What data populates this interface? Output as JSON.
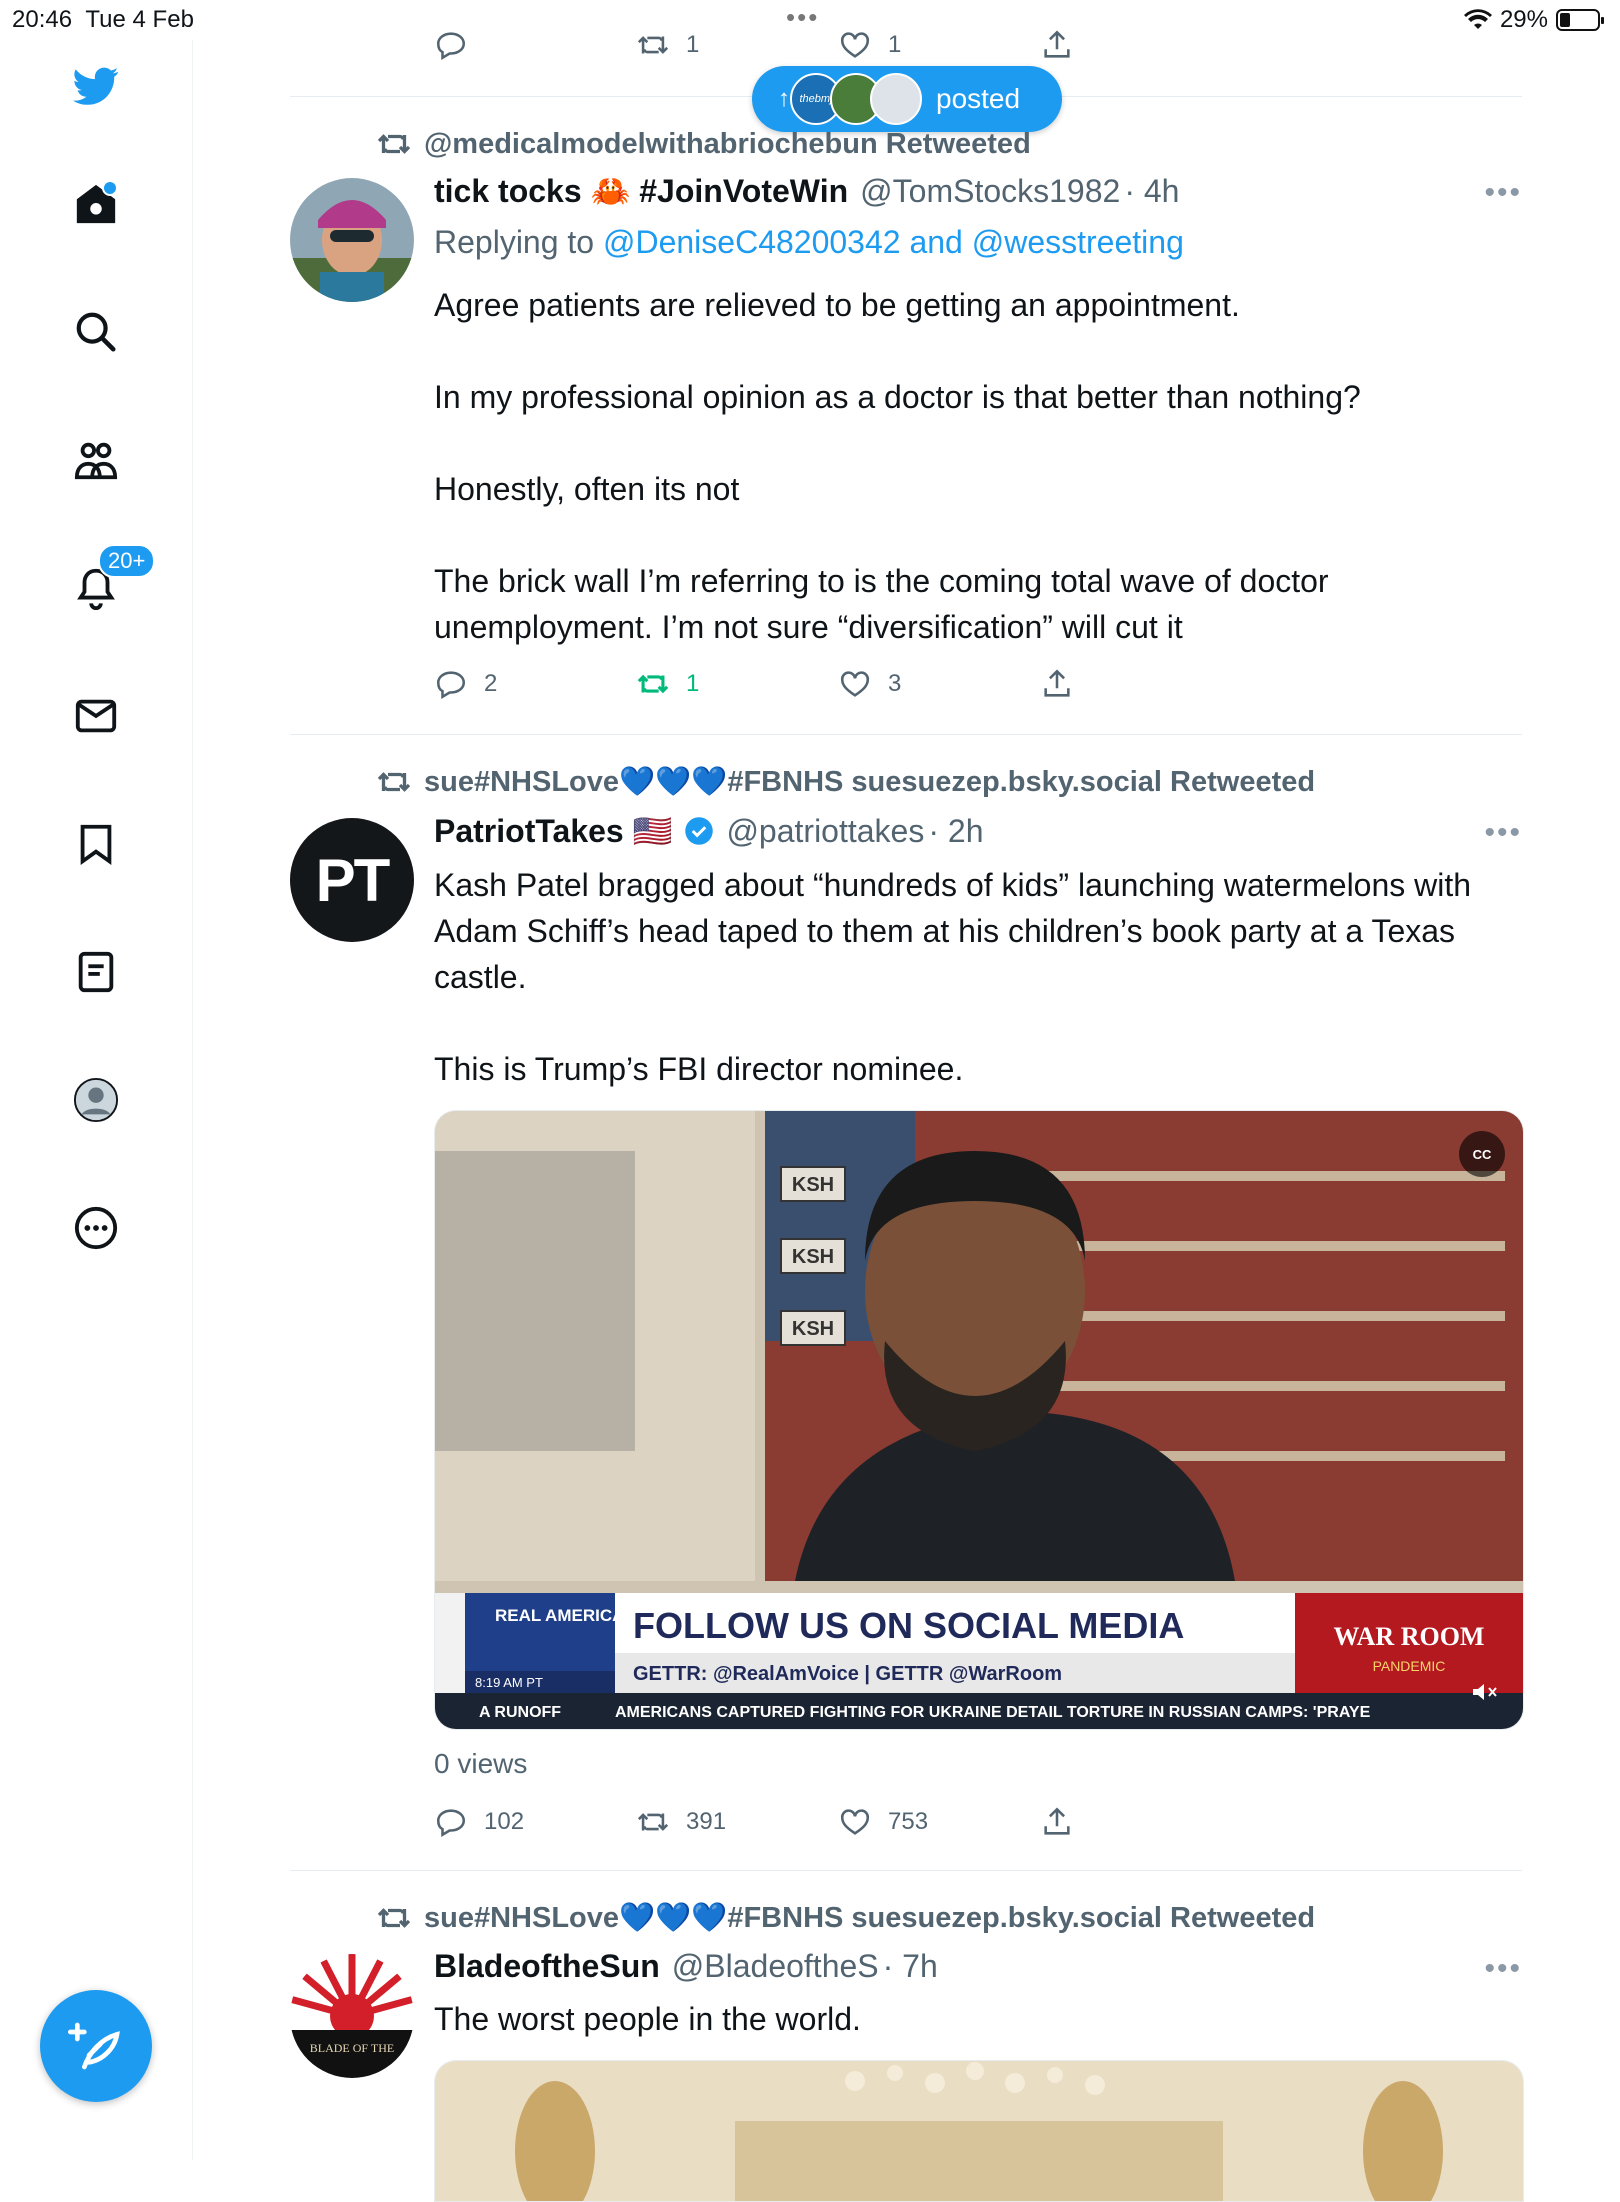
{
  "status_bar": {
    "time": "20:46",
    "date": "Tue 4 Feb",
    "battery": "29%",
    "battery_level": 0.29
  },
  "sidebar": {
    "notifications_badge": "20+",
    "items": [
      "home-icon",
      "search-icon",
      "communities-icon",
      "notifications-icon",
      "messages-icon",
      "bookmarks-icon",
      "lists-icon",
      "profile-icon",
      "more-icon"
    ]
  },
  "new_posts_pill": {
    "label": "posted",
    "avatar_text": "thebmj"
  },
  "prev_tweet_actions": {
    "retweets": "1",
    "likes": "1"
  },
  "tweets": [
    {
      "retweeted_by": "@medicalmodelwithabriochebun Retweeted",
      "name": "tick tocks 🦀 #JoinVoteWin",
      "handle": "@TomStocks1982",
      "time": "· 4h",
      "replying_prefix": "Replying to",
      "replying_to": "@DeniseC48200342 and @wesstreeting",
      "paragraphs": [
        "Agree patients are relieved to be getting an appointment.",
        "In my professional opinion as a doctor is that better than nothing?",
        "Honestly, often its not",
        "The brick wall I’m referring to is the coming total wave of doctor unemployment. I’m not sure “diversification” will cut it"
      ],
      "replies": "2",
      "retweets": "1",
      "likes": "3"
    },
    {
      "retweeted_by": "sue#NHSLove💙💙💙#FBNHS suesuezep.bsky.social Retweeted",
      "name": "PatriotTakes 🇺🇸",
      "handle": "@patriottakes",
      "time": "· 2h",
      "avatar_text": "PT",
      "paragraphs": [
        "Kash Patel bragged about “hundreds of kids” launching watermelons with Adam Schiff’s head taped to them at his children’s book party at a Texas castle.",
        "This is Trump’s FBI director nominee."
      ],
      "video": {
        "station": "REAL AMERICA'S VOICE",
        "clock": "8:19 AM PT",
        "headline": "FOLLOW US ON SOCIAL MEDIA",
        "subline": "GETTR: @RealAmVoice | GETTR @WarRoom",
        "show": "WAR ROOM",
        "show_sub": "PANDEMIC",
        "runoff": "A RUNOFF",
        "ticker": "AMERICANS CAPTURED FIGHTING FOR UKRAINE DETAIL TORTURE IN RUSSIAN CAMPS: 'PRAYE",
        "flag_labels": [
          "KSH",
          "KSH",
          "KSH"
        ],
        "cc": "CC"
      },
      "views": "0 views",
      "replies": "102",
      "retweets": "391",
      "likes": "753"
    },
    {
      "retweeted_by": "sue#NHSLove💙💙💙#FBNHS suesuezep.bsky.social Retweeted",
      "name": "BladeoftheSun",
      "handle": "@BladeoftheS",
      "time": "· 7h",
      "avatar_text": "BLADE OF THE",
      "paragraphs": [
        "The worst people in the world."
      ]
    }
  ],
  "colors": {
    "accent": "#1d9bf0",
    "retweet_green": "#00ba7c",
    "muted": "#536471"
  }
}
